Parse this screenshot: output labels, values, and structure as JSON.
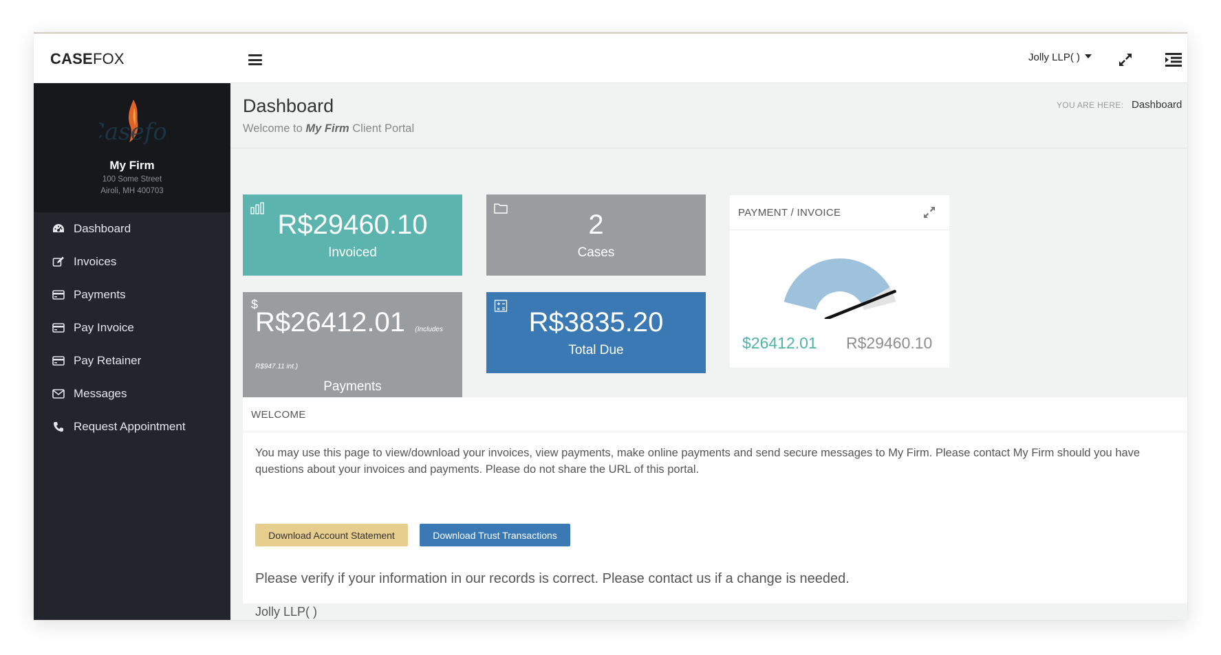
{
  "app": {
    "logo_bold": "CASE",
    "logo_light": "FOX",
    "user_menu": "Jolly LLP( )"
  },
  "profile": {
    "firm_name": "My Firm",
    "address_line1": "100 Some Street",
    "address_line2": "Airoli, MH 400703"
  },
  "sidebar": {
    "items": [
      {
        "label": "Dashboard",
        "icon": "dashboard-icon"
      },
      {
        "label": "Invoices",
        "icon": "edit-icon"
      },
      {
        "label": "Payments",
        "icon": "credit-card-icon"
      },
      {
        "label": "Pay Invoice",
        "icon": "credit-card-icon"
      },
      {
        "label": "Pay Retainer",
        "icon": "credit-card-icon"
      },
      {
        "label": "Messages",
        "icon": "envelope-icon"
      },
      {
        "label": "Request Appointment",
        "icon": "phone-icon"
      }
    ]
  },
  "header": {
    "title": "Dashboard",
    "subtitle_prefix": "Welcome to",
    "subtitle_firm": "My Firm",
    "subtitle_suffix": "Client Portal",
    "breadcrumb_label": "YOU ARE HERE:",
    "breadcrumb_current": "Dashboard"
  },
  "tiles": {
    "invoiced": {
      "value": "R$29460.10",
      "label": "Invoiced",
      "icon": "bar-chart-icon",
      "color": "#5bb5ae"
    },
    "cases": {
      "value": "2",
      "label": "Cases",
      "icon": "folder-icon",
      "color": "#9a9da0"
    },
    "payments": {
      "value": "R$26412.01",
      "note": "(Includes",
      "note2": "R$947.11 int.)",
      "label": "Payments",
      "icon": "dollar-icon",
      "color": "#9a9da0"
    },
    "total_due": {
      "value": "R$3835.20",
      "label": "Total Due",
      "icon": "calculator-icon",
      "color": "#3b79b4"
    }
  },
  "gauge": {
    "title": "PAYMENT / INVOICE",
    "paid_label": "$26412.01",
    "invoice_label": "R$29460.10",
    "fraction": 0.8965,
    "colors": {
      "arc": "#9fc2dc",
      "track": "#e3e3e3",
      "needle": "#111111"
    }
  },
  "welcome": {
    "title": "WELCOME",
    "text": "You may use this page to view/download your invoices, view payments, make online payments and send secure messages to My Firm. Please contact My Firm should you have questions about your invoices and payments. Please do not share the URL of this portal.",
    "btn_statement": "Download Account Statement",
    "btn_trust": "Download Trust Transactions",
    "verify_text": "Please verify if your information in our records is correct. Please contact us if a change is needed.",
    "client_name": "Jolly LLP( )"
  }
}
